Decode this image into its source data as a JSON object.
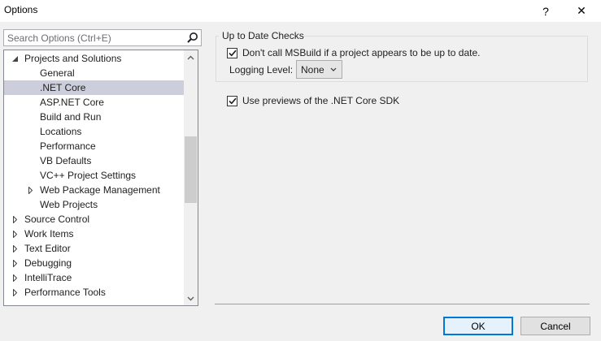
{
  "window": {
    "title": "Options",
    "help": "?",
    "close": "✕"
  },
  "search": {
    "placeholder": "Search Options (Ctrl+E)"
  },
  "tree": {
    "items": [
      {
        "label": "Projects and Solutions",
        "level": 0,
        "expander": "expanded"
      },
      {
        "label": "General",
        "level": 1
      },
      {
        "label": ".NET Core",
        "level": 1,
        "selected": true
      },
      {
        "label": "ASP.NET Core",
        "level": 1
      },
      {
        "label": "Build and Run",
        "level": 1
      },
      {
        "label": "Locations",
        "level": 1
      },
      {
        "label": "Performance",
        "level": 1
      },
      {
        "label": "VB Defaults",
        "level": 1
      },
      {
        "label": "VC++ Project Settings",
        "level": 1
      },
      {
        "label": "Web Package Management",
        "level": 1,
        "expander": "collapsed"
      },
      {
        "label": "Web Projects",
        "level": 1
      },
      {
        "label": "Source Control",
        "level": 0,
        "expander": "collapsed"
      },
      {
        "label": "Work Items",
        "level": 0,
        "expander": "collapsed"
      },
      {
        "label": "Text Editor",
        "level": 0,
        "expander": "collapsed"
      },
      {
        "label": "Debugging",
        "level": 0,
        "expander": "collapsed"
      },
      {
        "label": "IntelliTrace",
        "level": 0,
        "expander": "collapsed"
      },
      {
        "label": "Performance Tools",
        "level": 0,
        "expander": "collapsed"
      }
    ]
  },
  "settings": {
    "group_title": "Up to Date Checks",
    "dont_call_msbuild": {
      "label": "Don't call MSBuild if a project appears to be up to date.",
      "checked": true
    },
    "logging": {
      "label": "Logging Level:",
      "value": "None"
    },
    "use_previews": {
      "label": "Use previews of the .NET Core SDK",
      "checked": true
    }
  },
  "buttons": {
    "ok": "OK",
    "cancel": "Cancel"
  },
  "colors": {
    "selection": "#cccedb",
    "accent": "#0078d7",
    "window_bg": "#f0f0f0"
  },
  "icons": {
    "search": "search-icon",
    "expanded": "triangle-expanded-icon",
    "collapsed": "triangle-collapsed-icon"
  }
}
